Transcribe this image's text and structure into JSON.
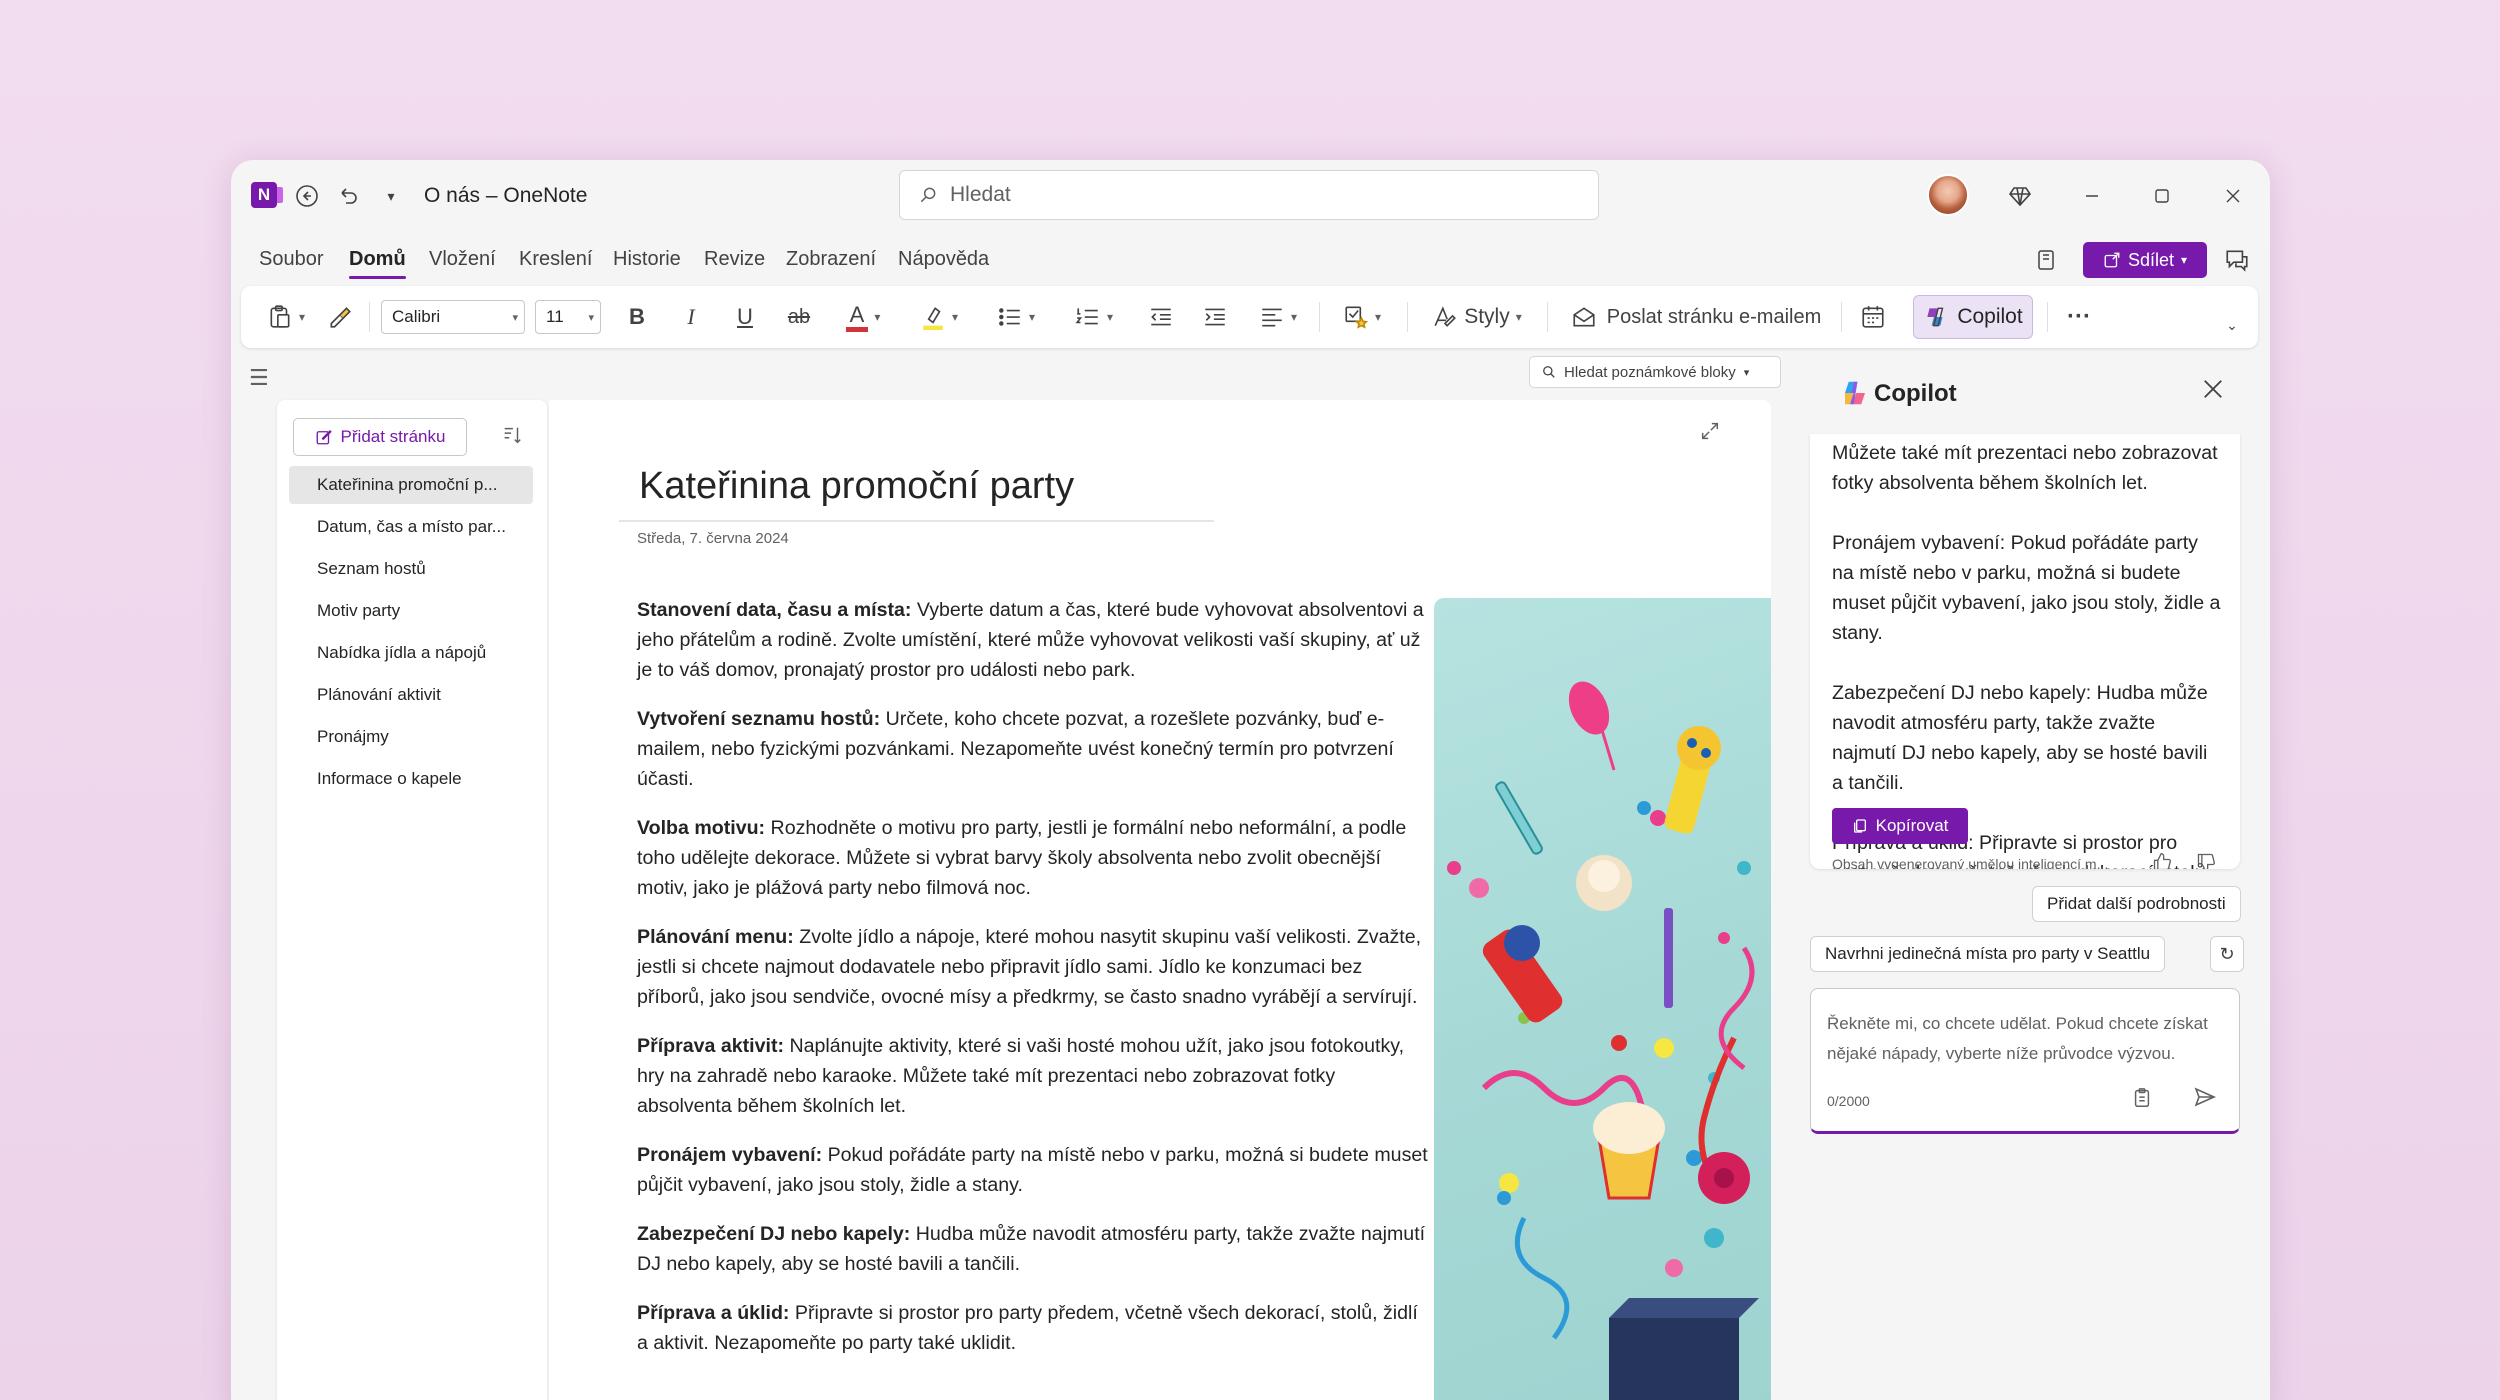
{
  "window": {
    "title": "O nás – OneNote"
  },
  "search": {
    "placeholder": "Hledat"
  },
  "menu": [
    "Soubor",
    "Domů",
    "Vložení",
    "Kreslení",
    "Historie",
    "Revize",
    "Zobrazení",
    "Nápověda"
  ],
  "menu_active": "Domů",
  "share_label": "Sdílet",
  "ribbon": {
    "font_name": "Calibri",
    "font_size": "11",
    "bold": "B",
    "italic": "I",
    "underline": "U",
    "strike": "ab",
    "styles_label": "Styly",
    "email_label": "Poslat stránku e-mailem",
    "copilot_label": "Copilot",
    "more": "···"
  },
  "notebook_search": "Hledat poznámkové bloky",
  "pages": {
    "add_label": "Přidat stránku",
    "items": [
      "Kateřinina promoční p...",
      "Datum, čas a místo par...",
      "Seznam hostů",
      "Motiv party",
      "Nabídka jídla a nápojů",
      "Plánování aktivit",
      "Pronájmy",
      "Informace o kapele"
    ]
  },
  "page": {
    "title": "Kateřinina promoční party",
    "date": "Středa, 7. června 2024",
    "paragraphs": [
      {
        "head": "Stanovení data, času a místa:",
        "text": " Vyberte datum a čas, které bude vyhovovat absolventovi a jeho přátelům a rodině. Zvolte umístění, které může vyhovovat velikosti vaší skupiny, ať už je to váš domov, pronajatý prostor pro události nebo park."
      },
      {
        "head": "Vytvoření seznamu hostů:",
        "text": " Určete, koho chcete pozvat, a rozešlete pozvánky, buď e-mailem, nebo fyzickými pozvánkami. Nezapomeňte uvést konečný termín pro potvrzení účasti."
      },
      {
        "head": "Volba motivu:",
        "text": " Rozhodněte o motivu pro party, jestli je formální nebo neformální, a podle toho udělejte dekorace. Můžete si vybrat barvy školy absolventa nebo zvolit obecnější motiv, jako je plážová party nebo filmová noc."
      },
      {
        "head": "Plánování menu:",
        "text": " Zvolte jídlo a nápoje, které mohou nasytit skupinu vaší velikosti. Zvažte, jestli si chcete najmout dodavatele nebo připravit jídlo sami. Jídlo ke konzumaci bez příborů, jako jsou sendviče, ovocné mísy a předkrmy, se často snadno vyrábějí a servírují."
      },
      {
        "head": "Příprava aktivit:",
        "text": " Naplánujte aktivity, které si vaši hosté mohou užít, jako jsou fotokoutky, hry na zahradě nebo karaoke. Můžete také mít prezentaci nebo zobrazovat fotky absolventa během školních let."
      },
      {
        "head": "Pronájem vybavení:",
        "text": " Pokud pořádáte party na místě nebo v parku, možná si budete muset půjčit vybavení, jako jsou stoly, židle a stany."
      },
      {
        "head": "Zabezpečení DJ nebo kapely:",
        "text": " Hudba může navodit atmosféru party, takže zvažte najmutí DJ nebo kapely, aby se hosté bavili a tančili."
      },
      {
        "head": "Příprava a úklid:",
        "text": " Připravte si prostor pro party předem, včetně všech dekorací, stolů, židlí a aktivit. Nezapomeňte po party také uklidit."
      }
    ]
  },
  "copilot": {
    "title": "Copilot",
    "response": [
      "fotokoutky, hry na zahradě nebo karaoke. Můžete také mít prezentaci nebo zobrazovat fotky absolventa během školních let.",
      "Pronájem vybavení: Pokud pořádáte party na místě nebo v parku, možná si budete muset půjčit vybavení, jako jsou stoly, židle a stany.",
      "Zabezpečení DJ nebo kapely: Hudba může navodit atmosféru party, takže zvažte najmutí DJ nebo kapely, aby se hosté bavili a tančili.",
      "Příprava a úklid: Připravte si prostor pro party předem, včetně všech dekorací, stolů, židlí a aktivit. Nezapomeňte po party také uklidit."
    ],
    "copy_label": "Kopírovat",
    "ai_note": "Obsah vygenerovaný umělou inteligencí m...",
    "chips": [
      "Přidat další podrobnosti",
      "Navrhni jedinečná místa pro party v Seattlu"
    ],
    "input_placeholder": "Řekněte mi, co chcete udělat. Pokud chcete získat nějaké nápady, vyberte níže průvodce výzvou.",
    "char_count": "0/2000"
  },
  "colors": {
    "accent": "#7719aa",
    "background": "#efd9ed"
  }
}
